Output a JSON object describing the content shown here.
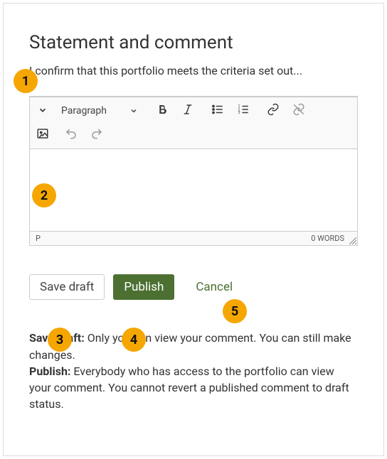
{
  "heading": "Statement and comment",
  "confirm_text": "I confirm that this portfolio meets the criteria set out...",
  "toolbar": {
    "paragraph_label": "Paragraph"
  },
  "editor_footer": {
    "path": "P",
    "wordcount": "0 WORDS"
  },
  "actions": {
    "save_draft": "Save draft",
    "publish": "Publish",
    "cancel": "Cancel"
  },
  "help": {
    "save_draft_label": "Save draft:",
    "save_draft_text": " Only you can view your comment. You can still make changes.",
    "publish_label": "Publish:",
    "publish_text": " Everybody who has access to the portfolio can view your comment. You cannot revert a published comment to draft status."
  },
  "callouts": {
    "c1": "1",
    "c2": "2",
    "c3": "3",
    "c4": "4",
    "c5": "5"
  }
}
